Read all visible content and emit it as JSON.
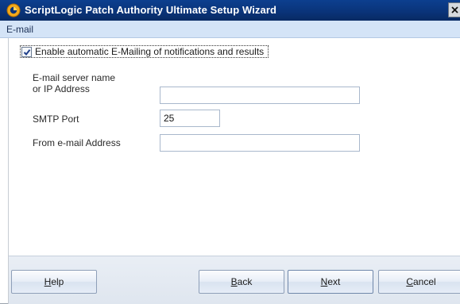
{
  "window": {
    "title": "ScriptLogic Patch Authority Ultimate Setup Wizard",
    "close_label": "×"
  },
  "section": {
    "title": "E-mail"
  },
  "email": {
    "enable_checked": true,
    "enable_label": "Enable automatic E-Mailing of notifications and results",
    "server_label_line1": "E-mail server name",
    "server_label_line2": "or IP Address",
    "server_value": "",
    "smtp_port_label": "SMTP Port",
    "smtp_port_value": "25",
    "from_label": "From e-mail Address",
    "from_value": ""
  },
  "buttons": {
    "help": {
      "accel": "H",
      "rest": "elp"
    },
    "back": {
      "accel": "B",
      "rest": "ack"
    },
    "next": {
      "accel": "N",
      "rest": "ext"
    },
    "cancel": {
      "accel": "C",
      "rest": "ancel"
    }
  },
  "colors": {
    "titlebar": "#0a347a",
    "section_bar": "#d4e4f7",
    "footer": "#e3e9f2"
  },
  "icons": {
    "app": "scriptlogic-logo-icon",
    "close": "close-icon",
    "check": "checkmark-icon"
  }
}
